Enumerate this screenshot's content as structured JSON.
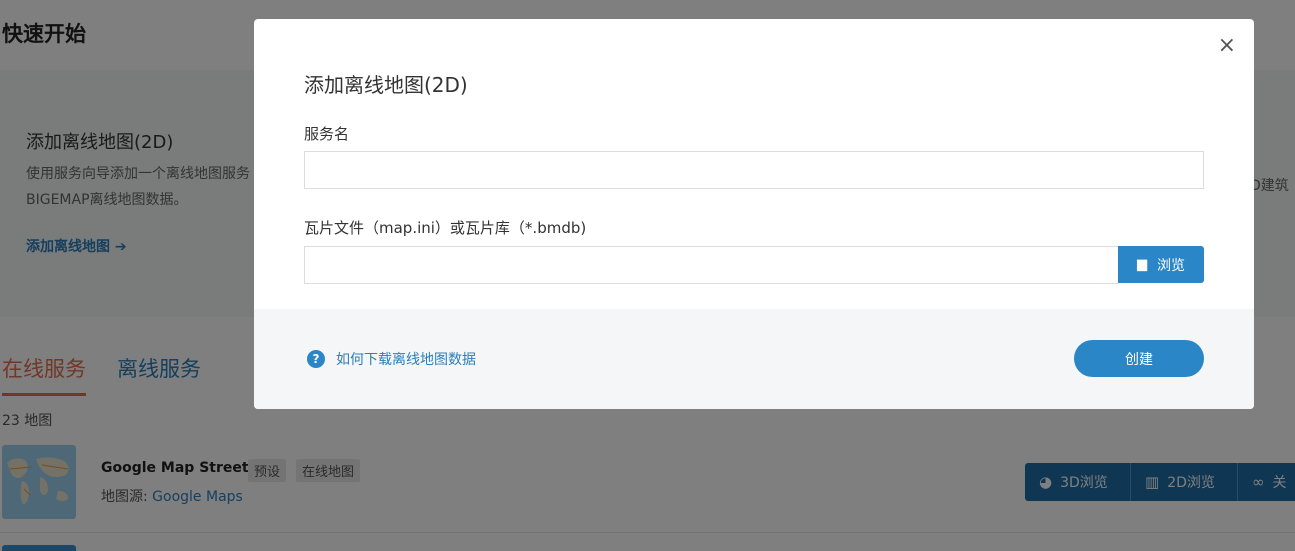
{
  "page": {
    "title": "快速开始",
    "card": {
      "title": "添加离线地图(2D)",
      "desc": "使用服务向导添加一个离线地图服务BIGEMAP离线地图数据。",
      "link": "添加离线地图",
      "right_text": "D建筑"
    },
    "tabs": [
      {
        "label": "在线服务",
        "active": true
      },
      {
        "label": "离线服务",
        "active": false
      }
    ],
    "map_count": "23 地图",
    "map_item": {
      "name": "Google Map Streets",
      "tags": [
        "预设",
        "在线地图"
      ],
      "source_label": "地图源:",
      "source_value": "Google Maps",
      "buttons": [
        {
          "label": "3D浏览",
          "icon": "globe-icon"
        },
        {
          "label": "2D浏览",
          "icon": "map-icon"
        },
        {
          "label": "关",
          "icon": "link-icon"
        }
      ]
    }
  },
  "modal": {
    "title": "添加离线地图(2D)",
    "close_glyph": "×",
    "service_name_label": "服务名",
    "service_name_value": "",
    "file_label": "瓦片文件（map.ini）或瓦片库（*.bmdb)",
    "file_value": "",
    "browse_label": "浏览",
    "help_glyph": "?",
    "help_link": "如何下载离线地图数据",
    "create_label": "创建"
  },
  "colors": {
    "accent": "#2a86c6",
    "link": "#2a7fbd",
    "tab_active": "#e36f4e",
    "dark_button": "#1f6ea8"
  }
}
